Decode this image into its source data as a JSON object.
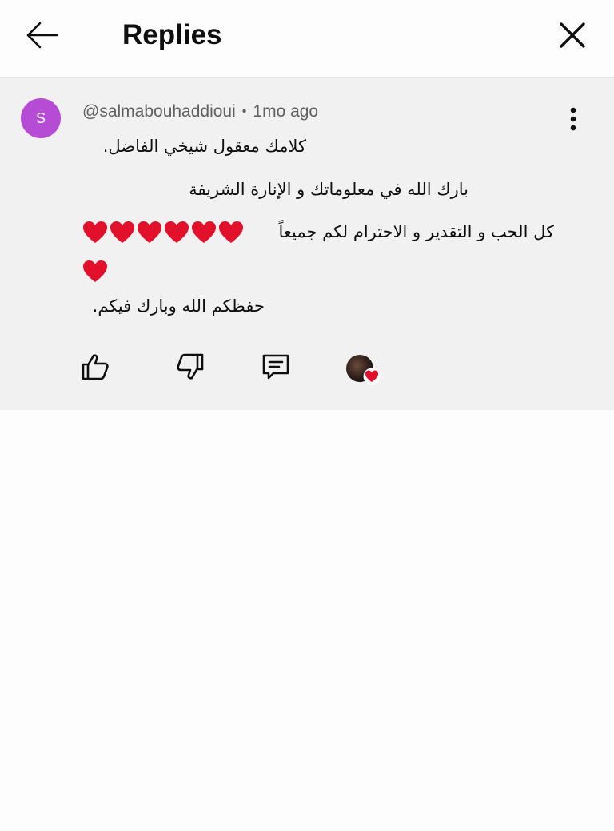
{
  "header": {
    "title": "Replies",
    "back_icon": "arrow-left-icon",
    "close_icon": "close-icon"
  },
  "comment": {
    "avatar_initial": "S",
    "avatar_color": "#b64bd6",
    "author": "@salmabouhaddioui",
    "separator": "•",
    "time": "1mo ago",
    "lines": [
      "كلامك معقول شيخي الفاضل.",
      "بارك الله في معلوماتك و الإنارة الشريفة",
      "كل الحب و التقدير و الاحترام لكم جميعاً",
      "حفظكم الله وبارك فيكم."
    ],
    "heart_emoji_count_row1": 6,
    "heart_emoji_count_row2": 1,
    "heart_color": "#e3102b"
  },
  "actions": {
    "like_icon": "thumbs-up-icon",
    "dislike_icon": "thumbs-down-icon",
    "reply_icon": "comment-icon",
    "creator_heart_icon": "creator-heart-icon"
  }
}
